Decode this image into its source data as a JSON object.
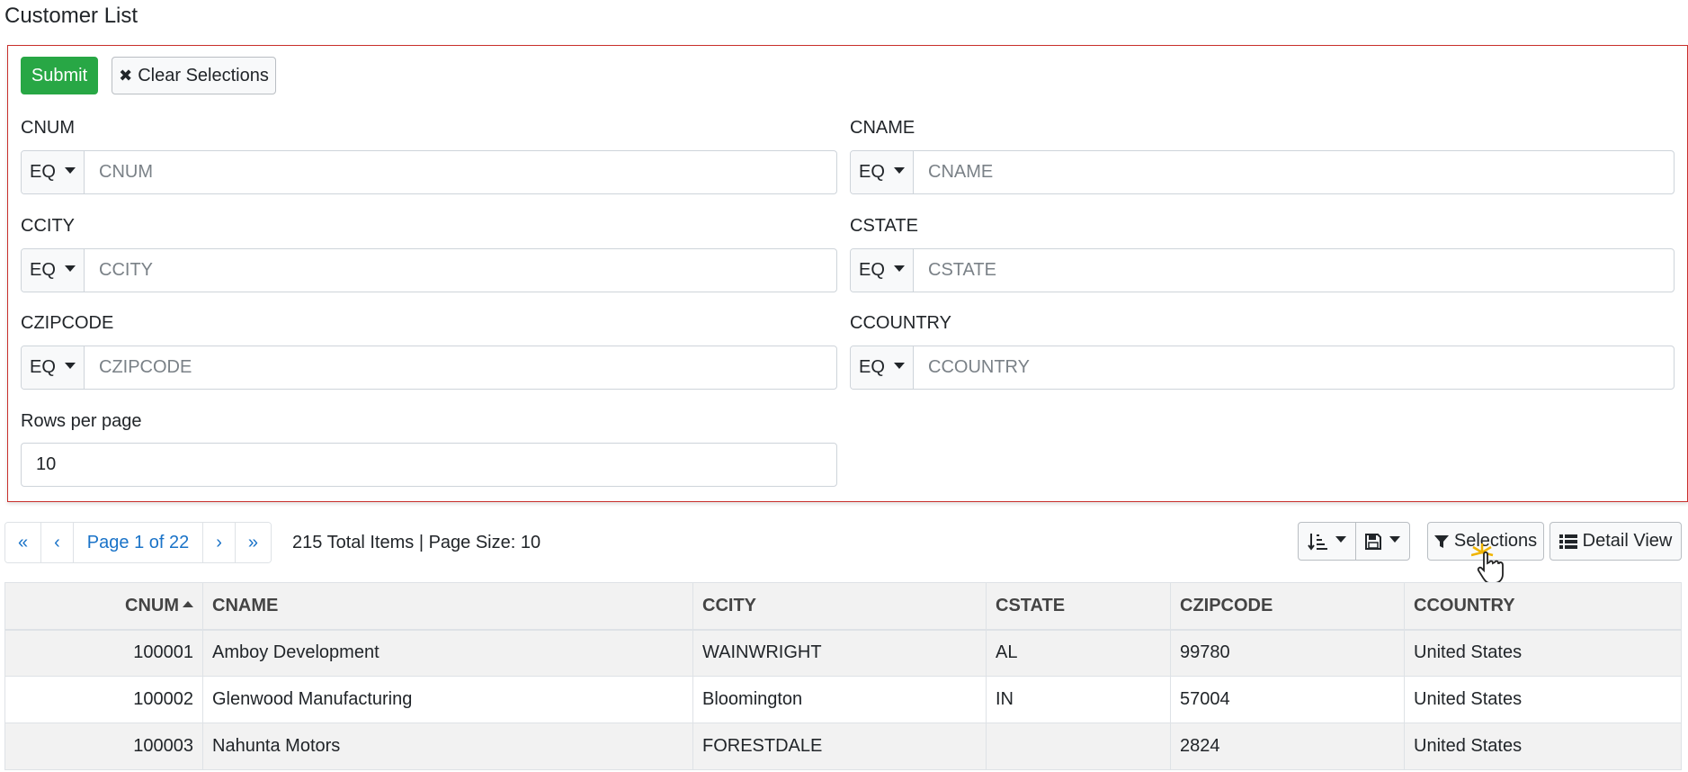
{
  "page": {
    "title": "Customer List"
  },
  "filters": {
    "submit_label": "Submit",
    "clear_label": "Clear Selections",
    "fields": {
      "cnum": {
        "label": "CNUM",
        "operator": "EQ",
        "placeholder": "CNUM",
        "value": ""
      },
      "cname": {
        "label": "CNAME",
        "operator": "EQ",
        "placeholder": "CNAME",
        "value": ""
      },
      "ccity": {
        "label": "CCITY",
        "operator": "EQ",
        "placeholder": "CCITY",
        "value": ""
      },
      "cstate": {
        "label": "CSTATE",
        "operator": "EQ",
        "placeholder": "CSTATE",
        "value": ""
      },
      "czipcode": {
        "label": "CZIPCODE",
        "operator": "EQ",
        "placeholder": "CZIPCODE",
        "value": ""
      },
      "ccountry": {
        "label": "CCOUNTRY",
        "operator": "EQ",
        "placeholder": "CCOUNTRY",
        "value": ""
      }
    },
    "rows_per_page": {
      "label": "Rows per page",
      "value": "10"
    }
  },
  "pagination": {
    "first": "«",
    "prev": "‹",
    "page_label": "Page 1 of 22",
    "next": "›",
    "last": "»",
    "summary": "215 Total Items | Page Size: 10"
  },
  "toolbar": {
    "sort_icon": "sort-amount-icon",
    "save_icon": "save-icon",
    "selections_label": "Selections",
    "detail_view_label": "Detail View"
  },
  "table": {
    "columns": [
      "CNUM",
      "CNAME",
      "CCITY",
      "CSTATE",
      "CZIPCODE",
      "CCOUNTRY"
    ],
    "sorted_column": "CNUM",
    "sort_direction": "ascending",
    "rows": [
      [
        "100001",
        "Amboy Development",
        "WAINWRIGHT",
        "AL",
        "99780",
        "United States"
      ],
      [
        "100002",
        "Glenwood Manufacturing",
        "Bloomington",
        "IN",
        "57004",
        "United States"
      ],
      [
        "100003",
        "Nahunta Motors",
        "FORESTDALE",
        "",
        "2824",
        "United States"
      ]
    ]
  },
  "colors": {
    "submit": "#28a745",
    "panel_border": "#c9302c",
    "link": "#1a73c8"
  }
}
